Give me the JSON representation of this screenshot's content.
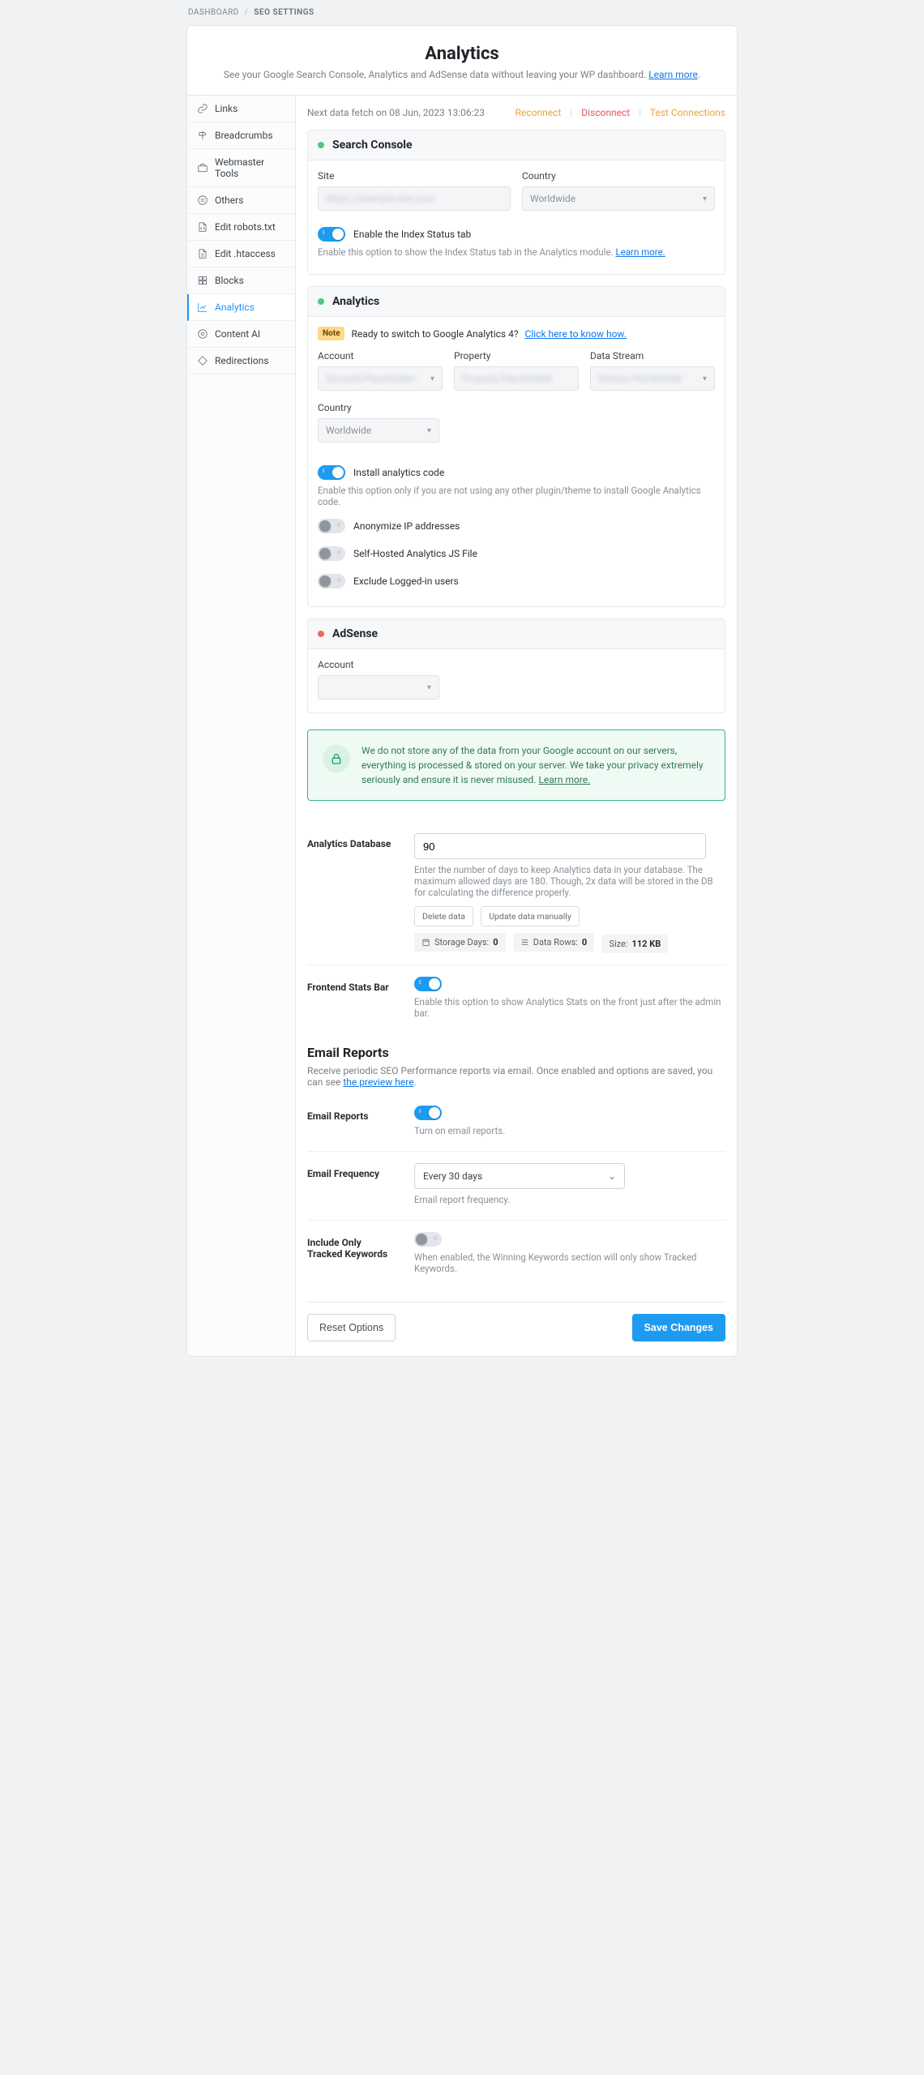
{
  "breadcrumb": {
    "root": "DASHBOARD",
    "current": "SEO SETTINGS"
  },
  "header": {
    "title": "Analytics",
    "subtitle": "See your Google Search Console, Analytics and AdSense data without leaving your WP dashboard.",
    "learn_more": "Learn more"
  },
  "sidebar": {
    "items": [
      {
        "label": "Links"
      },
      {
        "label": "Breadcrumbs"
      },
      {
        "label": "Webmaster Tools"
      },
      {
        "label": "Others"
      },
      {
        "label": "Edit robots.txt"
      },
      {
        "label": "Edit .htaccess"
      },
      {
        "label": "Blocks"
      },
      {
        "label": "Analytics"
      },
      {
        "label": "Content AI"
      },
      {
        "label": "Redirections"
      }
    ]
  },
  "top": {
    "fetch": "Next data fetch on 08 Jun, 2023 13:06:23",
    "reconnect": "Reconnect",
    "disconnect": "Disconnect",
    "test": "Test Connections"
  },
  "search_console": {
    "title": "Search Console",
    "site_label": "Site",
    "site_value": "https://example-site.com",
    "country_label": "Country",
    "country_value": "Worldwide",
    "toggle_label": "Enable the Index Status tab",
    "help": "Enable this option to show the Index Status tab in the Analytics module.",
    "learn_more": "Learn more."
  },
  "analytics_panel": {
    "title": "Analytics",
    "note_badge": "Note",
    "note_text": "Ready to switch to Google Analytics 4?",
    "note_link": "Click here to know how.",
    "account_label": "Account",
    "account_value": "Account Placeholder",
    "property_label": "Property",
    "property_value": "Property Placeholder",
    "stream_label": "Data Stream",
    "stream_value": "Stream Placeholder",
    "country_label": "Country",
    "country_value": "Worldwide",
    "install_label": "Install analytics code",
    "install_help": "Enable this option only if you are not using any other plugin/theme to install Google Analytics code.",
    "anon_label": "Anonymize IP addresses",
    "selfhost_label": "Self-Hosted Analytics JS File",
    "exclude_label": "Exclude Logged-in users"
  },
  "adsense": {
    "title": "AdSense",
    "account_label": "Account"
  },
  "privacy": {
    "text": "We do not store any of the data from your Google account on our servers, everything is processed & stored on your server. We take your privacy extremely seriously and ensure it is never misused.",
    "learn_more": "Learn more."
  },
  "db": {
    "label": "Analytics Database",
    "value": "90",
    "help": "Enter the number of days to keep Analytics data in your database. The maximum allowed days are 180. Though, 2x data will be stored in the DB for calculating the difference properly.",
    "delete_btn": "Delete data",
    "update_btn": "Update data manually",
    "storage_days_label": "Storage Days:",
    "storage_days_value": "0",
    "data_rows_label": "Data Rows:",
    "data_rows_value": "0",
    "size_label": "Size:",
    "size_value": "112 KB"
  },
  "frontend": {
    "label": "Frontend Stats Bar",
    "help": "Enable this option to show Analytics Stats on the front just after the admin bar."
  },
  "email": {
    "section_title": "Email Reports",
    "section_sub": "Receive periodic SEO Performance reports via email. Once enabled and options are saved, you can see",
    "section_link": "the preview here",
    "reports_label": "Email Reports",
    "reports_help": "Turn on email reports.",
    "freq_label": "Email Frequency",
    "freq_value": "Every 30 days",
    "freq_help": "Email report frequency.",
    "tracked_label": "Include Only Tracked Keywords",
    "tracked_help": "When enabled, the Winning Keywords section will only show Tracked Keywords."
  },
  "footer": {
    "reset": "Reset Options",
    "save": "Save Changes"
  }
}
